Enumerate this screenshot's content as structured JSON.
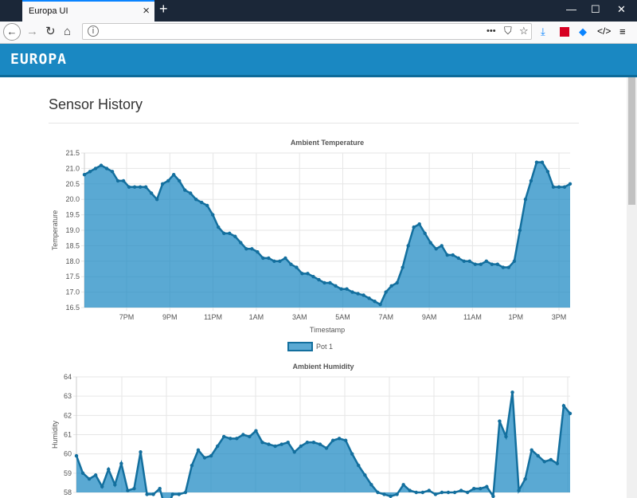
{
  "browser": {
    "tab_title": "Europa UI",
    "tab_close": "×",
    "new_tab": "+",
    "minimize": "—",
    "maximize": "☐",
    "close": "✕",
    "url": "",
    "page_actions": "•••"
  },
  "app": {
    "brand": "EUROPA",
    "page_title": "Sensor History"
  },
  "chart_data": [
    {
      "type": "area",
      "title": "Ambient Temperature",
      "xlabel": "Timestamp",
      "ylabel": "Temperature",
      "x_ticks": [
        "7PM",
        "9PM",
        "11PM",
        "1AM",
        "3AM",
        "5AM",
        "7AM",
        "9AM",
        "11AM",
        "1PM",
        "3PM"
      ],
      "y_ticks": [
        16.5,
        17.0,
        17.5,
        18.0,
        18.5,
        19.0,
        19.5,
        20.0,
        20.5,
        21.0,
        21.5
      ],
      "ylim": [
        16.5,
        21.5
      ],
      "grid": true,
      "legend": "bottom-center",
      "color": "#1a88c2",
      "series": [
        {
          "name": "Pot 1",
          "values": [
            20.8,
            20.9,
            21.0,
            21.1,
            21.0,
            20.9,
            20.6,
            20.6,
            20.4,
            20.4,
            20.4,
            20.4,
            20.2,
            20.0,
            20.5,
            20.6,
            20.8,
            20.6,
            20.3,
            20.2,
            20.0,
            19.9,
            19.8,
            19.5,
            19.1,
            18.9,
            18.9,
            18.8,
            18.6,
            18.4,
            18.4,
            18.3,
            18.1,
            18.1,
            18.0,
            18.0,
            18.1,
            17.9,
            17.8,
            17.6,
            17.6,
            17.5,
            17.4,
            17.3,
            17.3,
            17.2,
            17.1,
            17.1,
            17.0,
            16.95,
            16.9,
            16.8,
            16.7,
            16.6,
            17.0,
            17.2,
            17.3,
            17.8,
            18.5,
            19.1,
            19.2,
            18.9,
            18.6,
            18.4,
            18.5,
            18.2,
            18.2,
            18.1,
            18.0,
            18.0,
            17.9,
            17.9,
            18.0,
            17.9,
            17.9,
            17.8,
            17.8,
            18.0,
            19.0,
            20.0,
            20.6,
            21.2,
            21.2,
            20.9,
            20.4,
            20.4,
            20.4,
            20.5
          ]
        }
      ]
    },
    {
      "type": "area",
      "title": "Ambient Humidity",
      "xlabel": "",
      "ylabel": "Humidity",
      "y_ticks": [
        58,
        59,
        60,
        61,
        62,
        63,
        64
      ],
      "ylim": [
        58,
        64
      ],
      "grid": true,
      "color": "#1a88c2",
      "series": [
        {
          "name": "Pot 1",
          "values": [
            59.9,
            59.0,
            58.7,
            58.9,
            58.3,
            59.2,
            58.4,
            59.5,
            58.1,
            58.2,
            60.1,
            57.9,
            57.9,
            58.2,
            57.0,
            57.9,
            57.9,
            58.0,
            59.4,
            60.2,
            59.8,
            59.9,
            60.4,
            60.9,
            60.8,
            60.8,
            61.0,
            60.9,
            61.2,
            60.6,
            60.5,
            60.4,
            60.5,
            60.6,
            60.1,
            60.4,
            60.6,
            60.6,
            60.5,
            60.3,
            60.7,
            60.8,
            60.7,
            60.0,
            59.4,
            58.9,
            58.4,
            58.0,
            57.9,
            57.8,
            57.9,
            58.4,
            58.1,
            58.0,
            58.0,
            58.1,
            57.9,
            58.0,
            58.0,
            58.0,
            58.1,
            58.0,
            58.2,
            58.2,
            58.3,
            57.8,
            61.7,
            60.9,
            63.2,
            58.1,
            58.7,
            60.2,
            59.9,
            59.6,
            59.7,
            59.5,
            62.5,
            62.1
          ]
        }
      ]
    }
  ]
}
